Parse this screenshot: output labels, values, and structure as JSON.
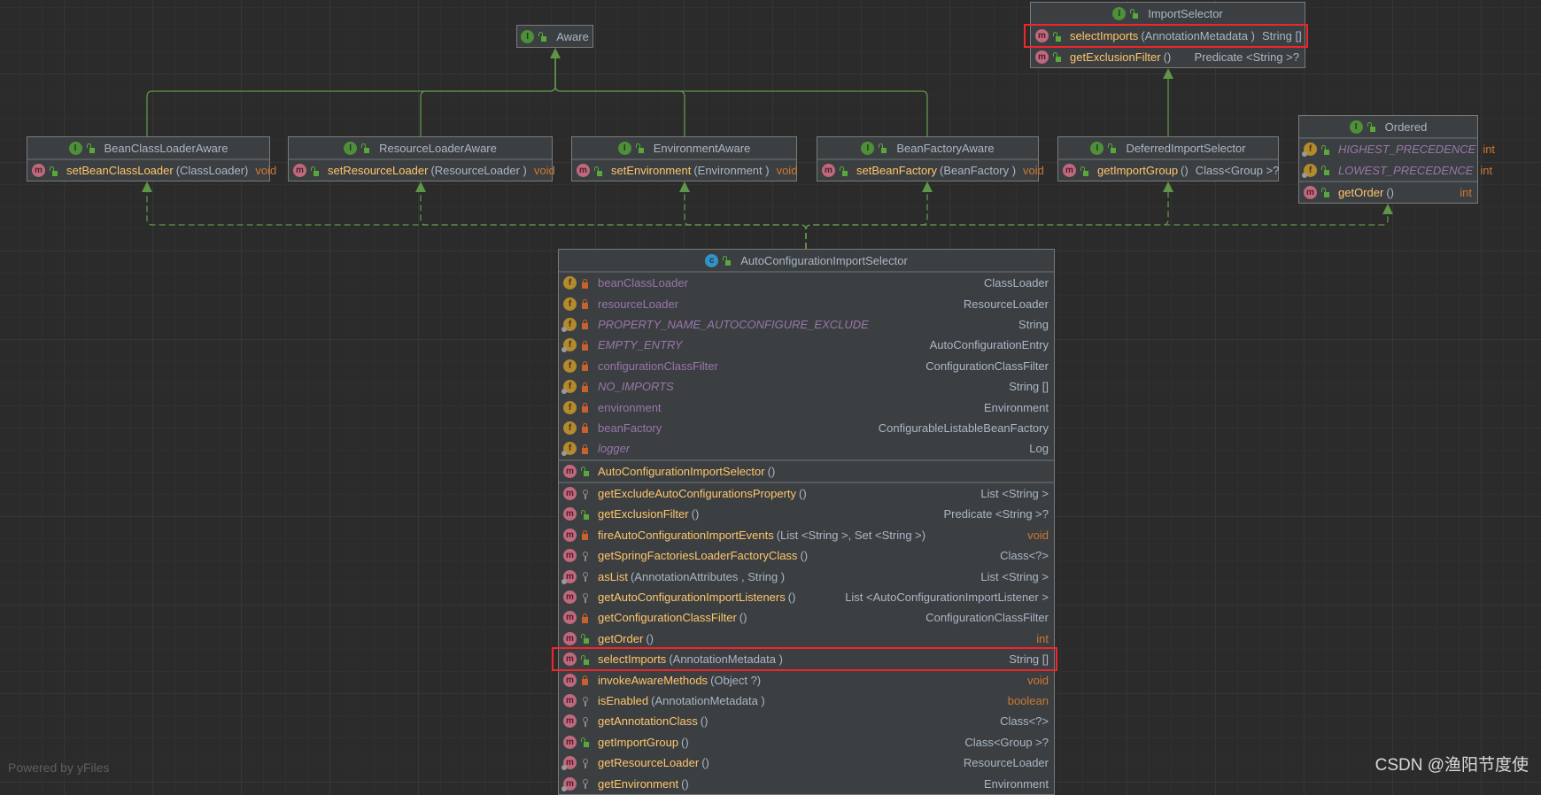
{
  "colors": {
    "background": "#2b2b2b",
    "node_fill": "#3c3f41",
    "edge": "#5f9548",
    "highlight": "#f0262b",
    "method_name": "#ffc66d",
    "field_name": "#9876aa",
    "keyword_type": "#cc7832",
    "type": "#a9b7c6"
  },
  "nodes": [
    {
      "id": "aware",
      "kind": "interface",
      "name": "Aware",
      "sections": []
    },
    {
      "id": "bean-class-loader-aware",
      "kind": "interface",
      "name": "BeanClassLoaderAware",
      "sections": [
        [
          {
            "icon": "method",
            "visibility": "public",
            "name": "setBeanClassLoader",
            "params": "(ClassLoader)",
            "type": "void"
          }
        ]
      ]
    },
    {
      "id": "resource-loader-aware",
      "kind": "interface",
      "name": "ResourceLoaderAware",
      "sections": [
        [
          {
            "icon": "method",
            "visibility": "public",
            "name": "setResourceLoader",
            "params": "(ResourceLoader )",
            "type": "void"
          }
        ]
      ]
    },
    {
      "id": "environment-aware",
      "kind": "interface",
      "name": "EnvironmentAware",
      "sections": [
        [
          {
            "icon": "method",
            "visibility": "public",
            "name": "setEnvironment",
            "params": "(Environment )",
            "type": "void"
          }
        ]
      ]
    },
    {
      "id": "bean-factory-aware",
      "kind": "interface",
      "name": "BeanFactoryAware",
      "sections": [
        [
          {
            "icon": "method",
            "visibility": "public",
            "name": "setBeanFactory",
            "params": "(BeanFactory )",
            "type": "void"
          }
        ]
      ]
    },
    {
      "id": "deferred-import-selector",
      "kind": "interface",
      "name": "DeferredImportSelector",
      "sections": [
        [
          {
            "icon": "method",
            "visibility": "public",
            "name": "getImportGroup",
            "params": "()",
            "type": "Class<Group >?"
          }
        ]
      ]
    },
    {
      "id": "import-selector",
      "kind": "interface",
      "name": "ImportSelector",
      "sections": [
        [
          {
            "icon": "method",
            "visibility": "public",
            "name": "selectImports",
            "params": "(AnnotationMetadata )",
            "type": "String []",
            "highlighted": true
          },
          {
            "icon": "method",
            "visibility": "public",
            "name": "getExclusionFilter",
            "params": "()",
            "type": "Predicate <String >?"
          }
        ]
      ]
    },
    {
      "id": "ordered",
      "kind": "interface",
      "name": "Ordered",
      "sections": [
        [
          {
            "icon": "field",
            "static": true,
            "visibility": "public",
            "name": "HIGHEST_PRECEDENCE",
            "type": "int"
          },
          {
            "icon": "field",
            "static": true,
            "visibility": "public",
            "name": "LOWEST_PRECEDENCE",
            "type": "int"
          }
        ],
        [
          {
            "icon": "method",
            "visibility": "public",
            "name": "getOrder",
            "params": "()",
            "type": "int"
          }
        ]
      ]
    },
    {
      "id": "auto-configuration-import-selector",
      "kind": "class",
      "name": "AutoConfigurationImportSelector",
      "sections": [
        [
          {
            "icon": "field",
            "visibility": "private",
            "name": "beanClassLoader",
            "type": "ClassLoader"
          },
          {
            "icon": "field",
            "visibility": "private",
            "name": "resourceLoader",
            "type": "ResourceLoader"
          },
          {
            "icon": "field",
            "static": true,
            "visibility": "private",
            "name": "PROPERTY_NAME_AUTOCONFIGURE_EXCLUDE",
            "type": "String"
          },
          {
            "icon": "field",
            "static": true,
            "visibility": "private",
            "name": "EMPTY_ENTRY",
            "type": "AutoConfigurationEntry"
          },
          {
            "icon": "field",
            "visibility": "private",
            "name": "configurationClassFilter",
            "type": "ConfigurationClassFilter"
          },
          {
            "icon": "field",
            "static": true,
            "visibility": "private",
            "name": "NO_IMPORTS",
            "type": "String []"
          },
          {
            "icon": "field",
            "visibility": "private",
            "name": "environment",
            "type": "Environment"
          },
          {
            "icon": "field",
            "visibility": "private",
            "name": "beanFactory",
            "type": "ConfigurableListableBeanFactory"
          },
          {
            "icon": "field",
            "static": true,
            "visibility": "private",
            "name": "logger",
            "type": "Log"
          }
        ],
        [
          {
            "icon": "method",
            "visibility": "public",
            "name": "AutoConfigurationImportSelector",
            "params": " ()",
            "type": ""
          }
        ],
        [
          {
            "icon": "method",
            "visibility": "protected",
            "name": "getExcludeAutoConfigurationsProperty",
            "params": " ()",
            "type": "List <String >"
          },
          {
            "icon": "method",
            "visibility": "public",
            "name": "getExclusionFilter",
            "params": "()",
            "type": "Predicate <String >?"
          },
          {
            "icon": "method",
            "visibility": "private",
            "name": "fireAutoConfigurationImportEvents",
            "params": " (List <String >, Set <String >)",
            "type": "void"
          },
          {
            "icon": "method",
            "visibility": "protected",
            "name": "getSpringFactoriesLoaderFactoryClass",
            "params": "()",
            "type": "Class<?>"
          },
          {
            "icon": "method",
            "static": true,
            "visibility": "protected",
            "name": "asList",
            "params": "(AnnotationAttributes  , String )",
            "type": "List <String >"
          },
          {
            "icon": "method",
            "visibility": "protected",
            "name": "getAutoConfigurationImportListeners",
            "params": " ()",
            "type": "List <AutoConfigurationImportListener  >"
          },
          {
            "icon": "method",
            "visibility": "private",
            "name": "getConfigurationClassFilter",
            "params": "()",
            "type": "ConfigurationClassFilter"
          },
          {
            "icon": "method",
            "visibility": "public",
            "name": "getOrder",
            "params": "()",
            "type": "int"
          },
          {
            "icon": "method",
            "visibility": "public",
            "name": "selectImports",
            "params": "(AnnotationMetadata )",
            "type": "String []",
            "highlighted": true
          },
          {
            "icon": "method",
            "visibility": "private",
            "name": "invokeAwareMethods",
            "params": "(Object ?)",
            "type": "void"
          },
          {
            "icon": "method",
            "visibility": "protected",
            "name": "isEnabled",
            "params": "(AnnotationMetadata )",
            "type": "boolean"
          },
          {
            "icon": "method",
            "visibility": "protected",
            "name": "getAnnotationClass",
            "params": "()",
            "type": "Class<?>"
          },
          {
            "icon": "method",
            "visibility": "public",
            "name": "getImportGroup",
            "params": "()",
            "type": "Class<Group >?"
          },
          {
            "icon": "method",
            "static": true,
            "visibility": "protected",
            "name": "getResourceLoader",
            "params": "()",
            "type": "ResourceLoader"
          },
          {
            "icon": "method",
            "static": true,
            "visibility": "protected",
            "name": "getEnvironment",
            "params": "()",
            "type": "Environment"
          }
        ]
      ]
    }
  ],
  "edges": [
    {
      "from": "bean-class-loader-aware",
      "to": "aware",
      "style": "extends"
    },
    {
      "from": "resource-loader-aware",
      "to": "aware",
      "style": "extends"
    },
    {
      "from": "environment-aware",
      "to": "aware",
      "style": "extends"
    },
    {
      "from": "bean-factory-aware",
      "to": "aware",
      "style": "extends"
    },
    {
      "from": "deferred-import-selector",
      "to": "import-selector",
      "style": "extends"
    },
    {
      "from": "auto-configuration-import-selector",
      "to": "bean-class-loader-aware",
      "style": "implements"
    },
    {
      "from": "auto-configuration-import-selector",
      "to": "resource-loader-aware",
      "style": "implements"
    },
    {
      "from": "auto-configuration-import-selector",
      "to": "environment-aware",
      "style": "implements"
    },
    {
      "from": "auto-configuration-import-selector",
      "to": "bean-factory-aware",
      "style": "implements"
    },
    {
      "from": "auto-configuration-import-selector",
      "to": "deferred-import-selector",
      "style": "implements"
    },
    {
      "from": "auto-configuration-import-selector",
      "to": "ordered",
      "style": "implements"
    }
  ],
  "footer": {
    "powered_by": "Powered by yFiles",
    "watermark": "CSDN @渔阳节度使"
  }
}
